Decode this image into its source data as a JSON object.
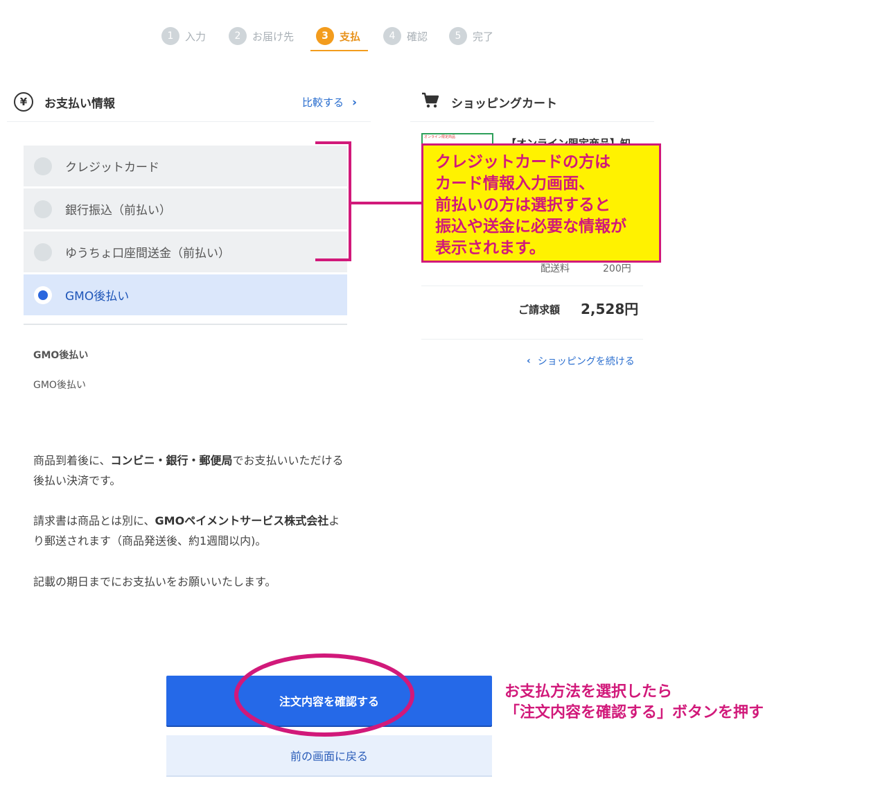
{
  "stepper": {
    "steps": [
      {
        "num": "1",
        "label": "入力"
      },
      {
        "num": "2",
        "label": "お届け先"
      },
      {
        "num": "3",
        "label": "支払"
      },
      {
        "num": "4",
        "label": "確認"
      },
      {
        "num": "5",
        "label": "完了"
      }
    ],
    "active_index": 2
  },
  "payment": {
    "icon": "yen-icon",
    "title": "お支払い情報",
    "compare_link": "比較する",
    "options": [
      {
        "label": "クレジットカード",
        "selected": false
      },
      {
        "label": "銀行振込（前払い）",
        "selected": false
      },
      {
        "label": "ゆうちょ口座間送金（前払い）",
        "selected": false
      },
      {
        "label": "GMO後払い",
        "selected": true
      }
    ],
    "detail_title": "GMO後払い",
    "detail_sub": "GMO後払い",
    "description": {
      "p1_pre": "商品到着後に、",
      "p1_bold": "コンビニ・銀行・郵便局",
      "p1_post": "でお支払いいただける後払い決済です。",
      "p2_pre": "請求書は商品とは別に、",
      "p2_bold": "GMOペイメントサービス株式会社",
      "p2_post": "より郵送されます（商品発送後、約1週間以内)。",
      "p3": "記載の期日までにお支払いをお願いいたします。"
    }
  },
  "cart": {
    "icon": "cart-icon",
    "title": "ショッピングカート",
    "product_name": "【オンライン限定商品】知",
    "thumbnail_text": "オンライン限定商品",
    "shipping_label": "配送料",
    "shipping_value": "200円",
    "total_label": "ご請求額",
    "total_value": "2,528円",
    "continue_link": "ショッピングを続ける"
  },
  "annotation": {
    "callout_lines": [
      "クレジットカードの方は",
      "カード情報入力画面、",
      "前払いの方は選択すると",
      "振込や送金に必要な情報が",
      "表示されます。"
    ],
    "note_lines": [
      "お支払方法を選択したら",
      "「注文内容を確認する」ボタンを押す"
    ],
    "accent_color": "#d1197a",
    "callout_bg": "#fff200"
  },
  "actions": {
    "confirm_label": "注文内容を確認する",
    "back_label": "前の画面に戻る"
  }
}
